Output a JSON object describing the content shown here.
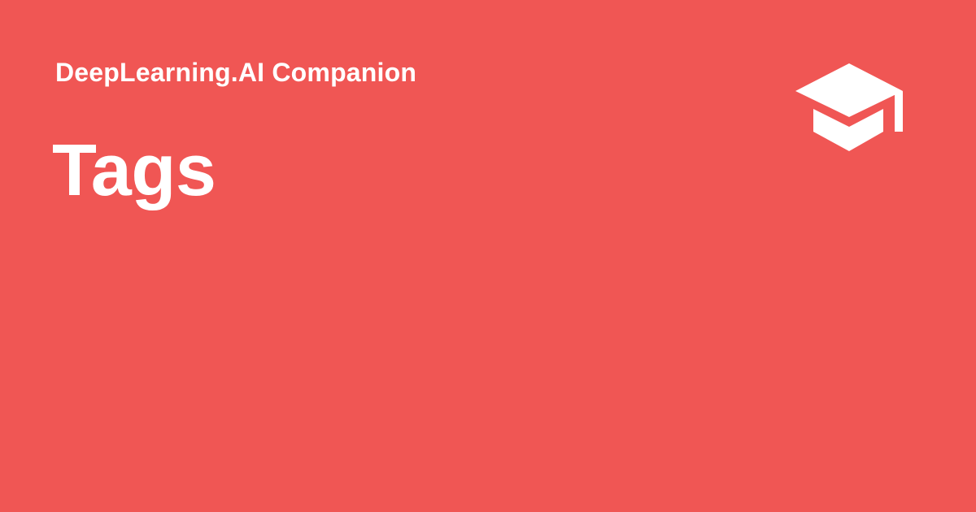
{
  "header": {
    "site_name": "DeepLearning.AI Companion",
    "logo_icon": "graduation-cap-icon"
  },
  "main": {
    "title": "Tags"
  },
  "colors": {
    "background": "#F05654",
    "foreground": "#FFFFFF"
  }
}
